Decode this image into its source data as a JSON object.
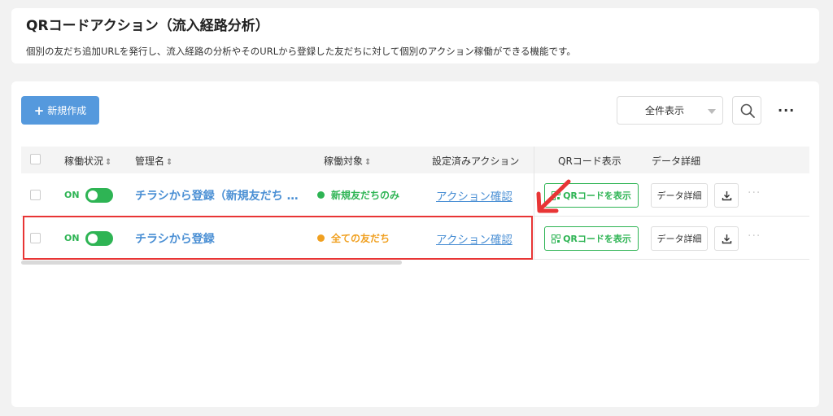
{
  "header": {
    "title": "QRコードアクション（流入経路分析）",
    "description": "個別の友だち追加URLを発行し、流入経路の分析やそのURLから登録した友だちに対して個別のアクション稼働ができる機能です。"
  },
  "toolbar": {
    "new_button_label": "新規作成",
    "filter_label": "全件表示",
    "more_label": "···"
  },
  "table": {
    "columns": {
      "status": "稼働状況",
      "name": "管理名",
      "target": "稼働対象",
      "actions": "設定済みアクション",
      "qr": "QRコード表示",
      "detail": "データ詳細"
    },
    "sort_glyph": "⇕",
    "rows": [
      {
        "status": "ON",
        "name": "チラシから登録（新規友だち …",
        "target": "新規友だちのみ",
        "target_color": "#2eb454",
        "action_link": "アクション確認",
        "qr_button": "QRコードを表示",
        "detail_button": "データ詳細",
        "more": "···"
      },
      {
        "status": "ON",
        "name": "チラシから登録",
        "target": "全ての友だち",
        "target_color": "#f0a020",
        "action_link": "アクション確認",
        "qr_button": "QRコードを表示",
        "detail_button": "データ詳細",
        "more": "···"
      }
    ]
  },
  "colors": {
    "accent_blue": "#5599dd",
    "link_blue": "#4a8fd4",
    "on_green": "#2eb454",
    "highlight_red": "#e83535"
  }
}
